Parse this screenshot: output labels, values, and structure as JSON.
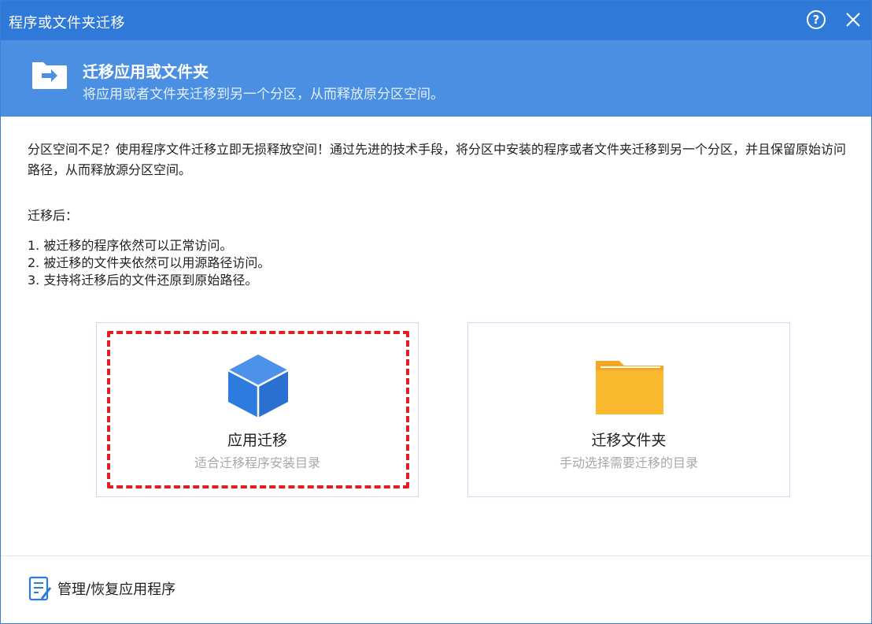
{
  "window": {
    "title": "程序或文件夹迁移"
  },
  "banner": {
    "title": "迁移应用或文件夹",
    "subtitle": "将应用或者文件夹迁移到另一个分区，从而释放原分区空间。"
  },
  "content": {
    "intro": "分区空间不足？使用程序文件迁移立即无损释放空间！通过先进的技术手段，将分区中安装的程序或者文件夹迁移到另一个分区，并且保留原始访问路径，从而释放源分区空间。",
    "after_label": "迁移后：",
    "bullets": [
      "1. 被迁移的程序依然可以正常访问。",
      "2. 被迁移的文件夹依然可以用源路径访问。",
      "3. 支持将迁移后的文件还原到原始路径。"
    ]
  },
  "cards": [
    {
      "label": "应用迁移",
      "desc": "适合迁移程序安装目录",
      "icon": "cube-icon"
    },
    {
      "label": "迁移文件夹",
      "desc": "手动选择需要迁移的目录",
      "icon": "folder-icon"
    }
  ],
  "footer": {
    "manage_label": "管理/恢复应用程序"
  },
  "colors": {
    "titlebar": "#2f7ad8",
    "banner": "#4a8fe2",
    "highlight": "#e02020",
    "cube": "#2e7be0",
    "folder": "#fbb930"
  }
}
